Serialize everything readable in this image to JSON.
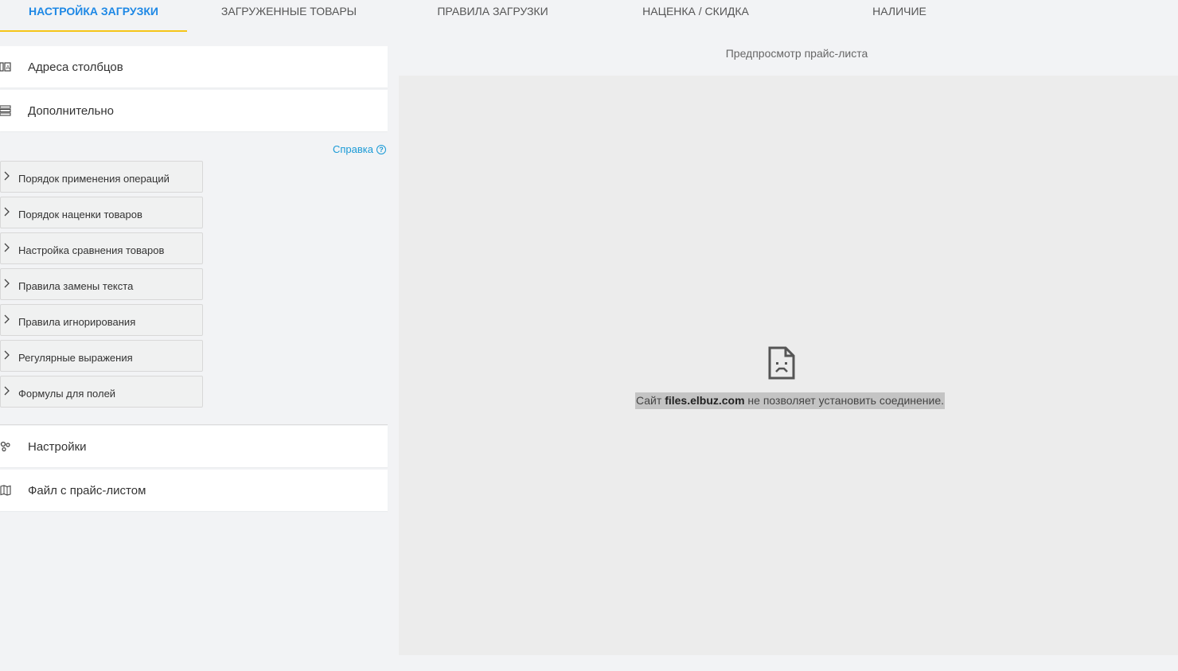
{
  "tabs": [
    {
      "label": "НАСТРОЙКА ЗАГРУЗКИ",
      "active": true
    },
    {
      "label": "ЗАГРУЖЕННЫЕ ТОВАРЫ",
      "active": false
    },
    {
      "label": "ПРАВИЛА ЗАГРУЗКИ",
      "active": false
    },
    {
      "label": "НАЦЕНКА / СКИДКА",
      "active": false
    },
    {
      "label": "НАЛИЧИЕ",
      "active": false
    }
  ],
  "sections_top": [
    {
      "label": "Адреса столбцов",
      "icon": "column-address-icon"
    },
    {
      "label": "Дополнительно",
      "icon": "list-settings-icon"
    }
  ],
  "help": {
    "label": "Справка",
    "icon": "question-circle-icon"
  },
  "accordion": [
    {
      "label": "Порядок применения операций"
    },
    {
      "label": "Порядок наценки товаров"
    },
    {
      "label": "Настройка сравнения товаров"
    },
    {
      "label": "Правила замены текста"
    },
    {
      "label": "Правила игнорирования"
    },
    {
      "label": "Регулярные выражения"
    },
    {
      "label": "Формулы для полей"
    }
  ],
  "sections_bottom": [
    {
      "label": "Настройки",
      "icon": "gears-icon"
    },
    {
      "label": "Файл с прайс-листом",
      "icon": "map-icon"
    }
  ],
  "preview": {
    "title": "Предпросмотр прайс-листа",
    "error": {
      "prefix": "Сайт ",
      "host": "files.elbuz.com",
      "suffix": " не позволяет установить соединение.",
      "icon": "sad-document-icon"
    }
  },
  "colors": {
    "accent_blue": "#1e88e5",
    "tab_underline": "#f5c518",
    "help_link": "#1a9ad6"
  }
}
